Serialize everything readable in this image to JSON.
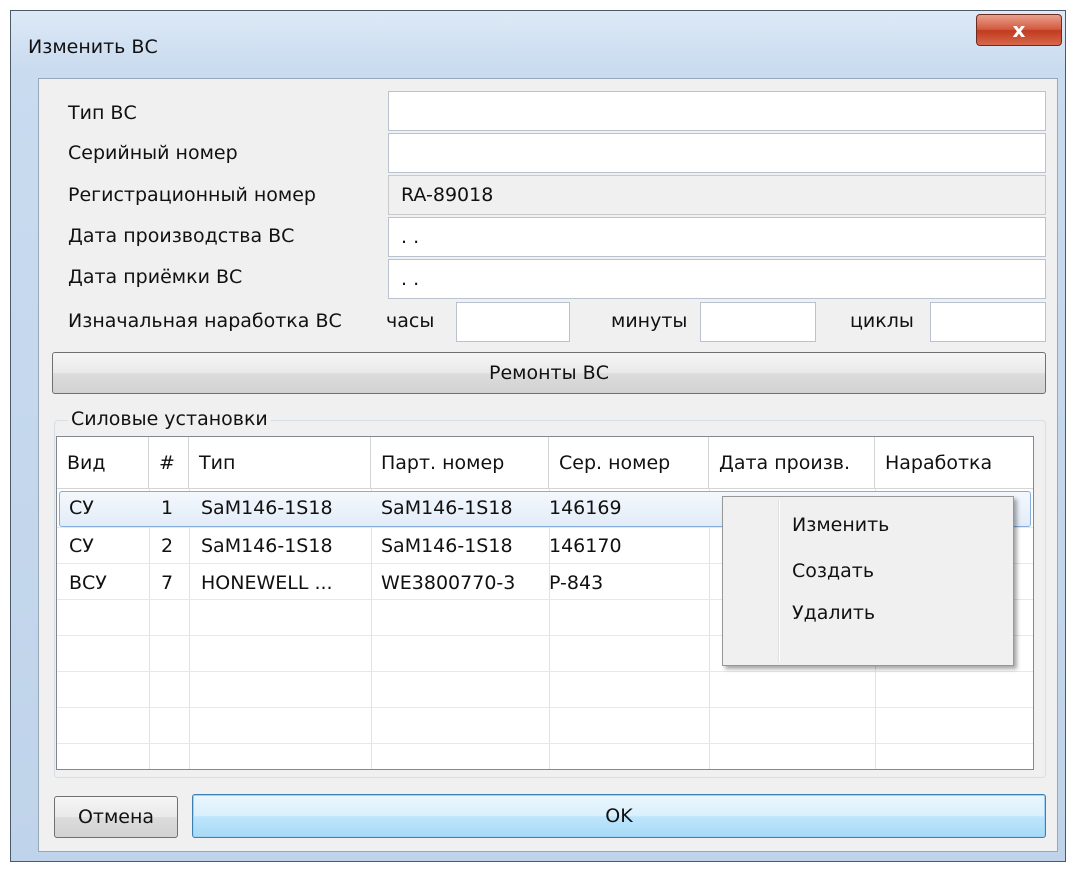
{
  "window": {
    "title": "Изменить ВС",
    "close_glyph": "x"
  },
  "form": {
    "type_label": "Тип ВС",
    "type_value": "",
    "serial_label": "Серийный номер",
    "serial_value": "",
    "reg_label": "Регистрационный номер",
    "reg_value": "RA-89018",
    "prod_date_label": "Дата производства ВС",
    "prod_date_value": ". .",
    "accept_date_label": "Дата приёмки ВС",
    "accept_date_value": ". .",
    "initial_hours_label": "Изначальная наработка ВС",
    "hours_label": "часы",
    "hours_value": "",
    "minutes_label": "минуты",
    "minutes_value": "",
    "cycles_label": "циклы",
    "cycles_value": ""
  },
  "repairs_button": "Ремонты ВС",
  "group": {
    "title": "Силовые установки",
    "columns": [
      "Вид",
      "#",
      "Тип",
      "Парт. номер",
      "Сер. номер",
      "Дата произв.",
      "Наработка"
    ],
    "rows": [
      [
        "СУ",
        "1",
        "SaM146-1S18",
        "SaM146-1S18",
        "146169"
      ],
      [
        "СУ",
        "2",
        "SaM146-1S18",
        "SaM146-1S18",
        "146170"
      ],
      [
        "ВСУ",
        "7",
        "HONEWELL ...",
        "WE3800770-3",
        "P-843"
      ]
    ]
  },
  "context_menu": {
    "items": [
      "Изменить",
      "Создать",
      "Удалить"
    ]
  },
  "footer": {
    "cancel_label": "Отмена",
    "ok_label": "OK"
  }
}
